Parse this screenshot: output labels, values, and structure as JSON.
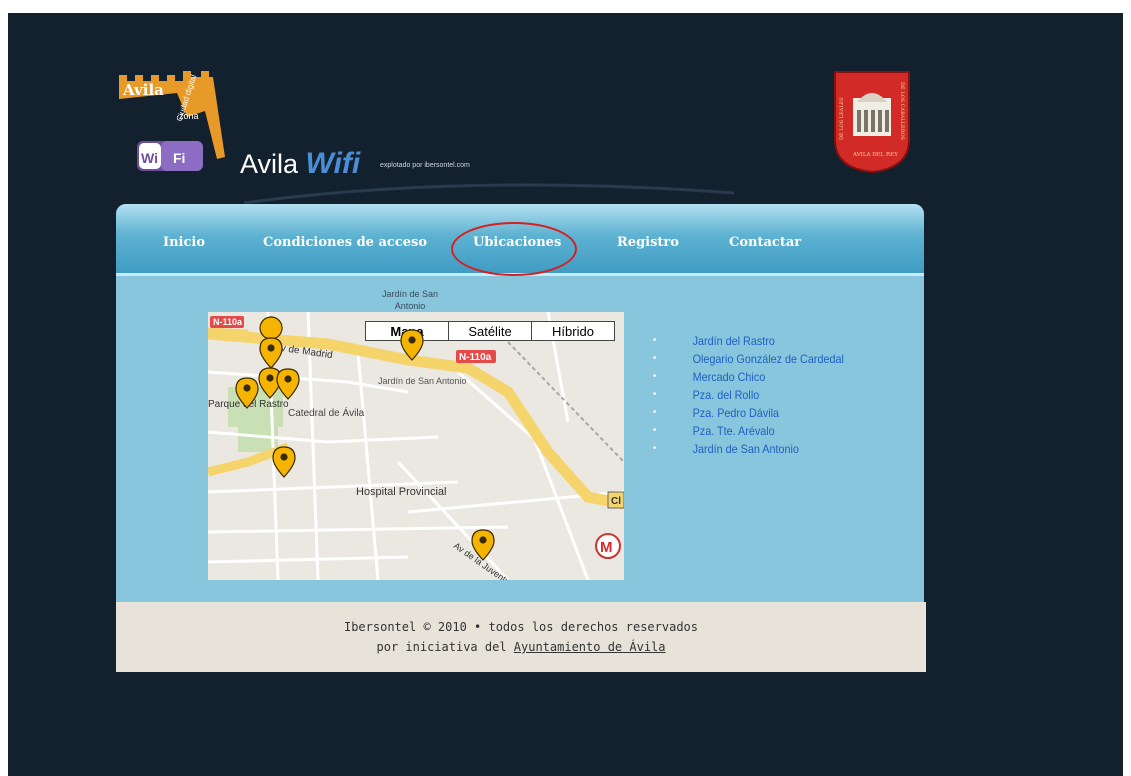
{
  "header": {
    "logo_text_1": "Avila",
    "logo_text_2": "Ciudad digital",
    "logo_text_3": "zona",
    "logo_wi": "Wi",
    "logo_fi": "Fi",
    "title_plain": "Avila ",
    "title_wifi": "Wifi",
    "subtitle": "explotado por ibersontel.com",
    "shield_left": "DE LOS LEALES",
    "shield_right": "DE LOS CABALLEROS",
    "shield_bottom": "AVILA DEL REY"
  },
  "nav": {
    "items": [
      {
        "label": "Inicio"
      },
      {
        "label": "Condiciones de acceso"
      },
      {
        "label": "Ubicaciones"
      },
      {
        "label": "Registro"
      },
      {
        "label": "Contactar"
      }
    ]
  },
  "map": {
    "top_label": "Jardín de San Antonio",
    "map_types": [
      "Mapa",
      "Satélite",
      "Híbrido"
    ],
    "road_1": "N-110a",
    "road_2": "N-110a",
    "street_1": "Av de Madrid",
    "place_1": "Jardín de San Antonio",
    "place_2": "Parque del Rastro",
    "place_3": "Catedral de Ávila",
    "place_4": "Hospital Provincial",
    "street_2": "Av de la Juventud",
    "edge_label": "Cl",
    "metro_icon": "M"
  },
  "locations": {
    "items": [
      "Jardín del Rastro",
      "Olegario González de Cardedal",
      "Mercado Chico",
      "Pza. del Rollo",
      "Pza. Pedro Dávila",
      "Pza. Tte. Arévalo",
      "Jardín de San Antonio"
    ]
  },
  "footer": {
    "line1": "Ibersontel © 2010 • todos los derechos reservados",
    "line2_prefix": "por iniciativa del ",
    "line2_link": "Ayuntamiento de Ávila"
  },
  "colors": {
    "page_bg": "#13202e",
    "nav_blue": "#3f9cc3",
    "content_blue": "#87c6dd",
    "link_blue": "#1f5fc2",
    "footer_bg": "#e7e3d8",
    "highlight_red": "#d61f1f"
  }
}
